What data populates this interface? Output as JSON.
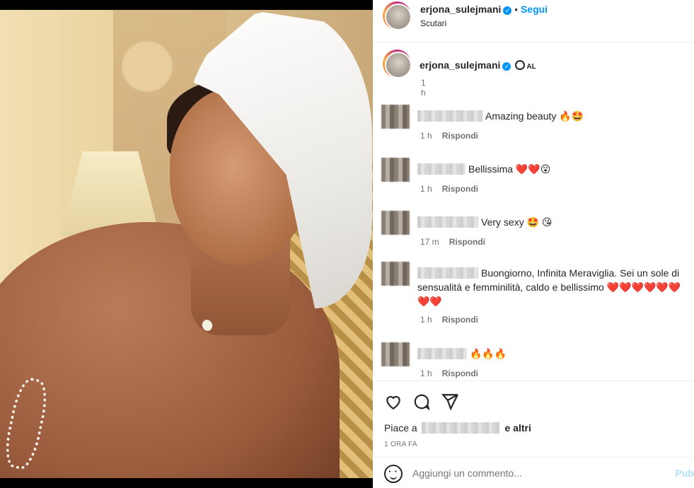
{
  "header": {
    "username": "erjona_sulejmani",
    "separator": "•",
    "follow_label": "Segui",
    "location": "Scutari"
  },
  "caption": {
    "username": "erjona_sulejmani",
    "lang": "AL",
    "time": "1 h"
  },
  "comments": [
    {
      "text": "Amazing beauty 🔥🤩",
      "time": "1 h",
      "reply": "Rispondi"
    },
    {
      "text": "Bellissima ❤️❤️😮",
      "time": "1 h",
      "reply": "Rispondi"
    },
    {
      "text": "Very sexy 🤩 😘",
      "time": "17 m",
      "reply": "Rispondi"
    },
    {
      "text": "Buongiorno, Infinita Meraviglia. Sei un sole di sensualità e femminilità, caldo e bellissimo ❤️❤️❤️❤️❤️❤️❤️❤️",
      "time": "1 h",
      "reply": "Rispondi"
    },
    {
      "text": "🔥🔥🔥",
      "time": "1 h",
      "reply": "Rispondi"
    }
  ],
  "actions": {
    "like_icon": "heart-icon",
    "comment_icon": "comment-icon",
    "share_icon": "send-icon",
    "likes_prefix": "Piace a",
    "likes_suffix": "e",
    "likes_others": "altri",
    "ago": "1 ORA FA"
  },
  "add_comment": {
    "placeholder": "Aggiungi un commento...",
    "post_label": "Pub"
  },
  "colors": {
    "accent": "#0095f6",
    "muted": "#737373"
  }
}
